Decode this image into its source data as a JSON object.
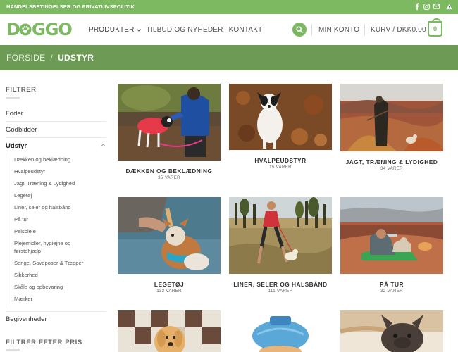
{
  "topbar": {
    "links": "HANDELSBETINGELSER OG PRIVATLIVSPOLITIK",
    "social": [
      "facebook-icon",
      "instagram-icon",
      "email-icon",
      "warning-icon"
    ]
  },
  "header": {
    "logo": "DOGGO",
    "nav": [
      "PRODUKTER",
      "TILBUD OG NYHEDER",
      "KONTAKT"
    ],
    "account": "MIN KONTO",
    "cart_label": "KURV / DKK0.00",
    "cart_count": "0"
  },
  "breadcrumb": {
    "home": "FORSIDE",
    "sep": "/",
    "current": "UDSTYR"
  },
  "sidebar": {
    "filter_title": "FILTRER",
    "categories": [
      "Foder",
      "Godbidder",
      "Udstyr",
      "Begivenheder"
    ],
    "subcategories": [
      "Dækken og beklædning",
      "Hvalpeudstyr",
      "Jagt, Træning & Lydighed",
      "Legetøj",
      "Liner, seler og halsbånd",
      "På tur",
      "Pelspleje",
      "Plejemidler, hygiejne og førstehjælp",
      "Senge, Soveposer & Tæpper",
      "Sikkerhed",
      "Skåle og opbevaring",
      "Mærker"
    ],
    "price_filter_title": "FILTRER EFTER PRIS"
  },
  "products": [
    {
      "title": "DÆKKEN OG BEKLÆDNING",
      "count": "35 VARER"
    },
    {
      "title": "HVALPEUDSTYR",
      "count": "15 VARER"
    },
    {
      "title": "JAGT, TRÆNING & LYDIGHED",
      "count": "34 VARER"
    },
    {
      "title": "LEGETØJ",
      "count": "132 VARER"
    },
    {
      "title": "LINER, SELER OG HALSBÅND",
      "count": "111 VARER"
    },
    {
      "title": "PÅ TUR",
      "count": "32 VARER"
    },
    {
      "title": "",
      "count": ""
    },
    {
      "title": "",
      "count": ""
    },
    {
      "title": "",
      "count": ""
    }
  ],
  "colors": {
    "brand_green": "#7cb961",
    "band_green": "#6d9b56"
  }
}
